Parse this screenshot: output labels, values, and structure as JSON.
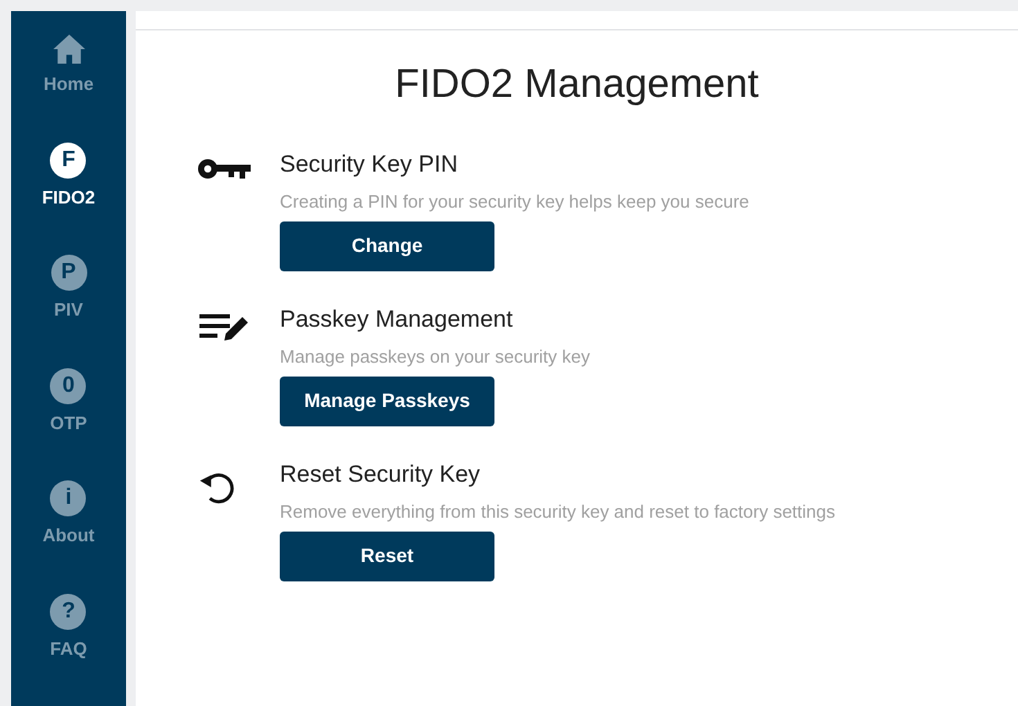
{
  "sidebar": {
    "items": [
      {
        "kind": "home",
        "label": "Home",
        "selected": false
      },
      {
        "kind": "badge",
        "badge": "F",
        "label": "FIDO2",
        "selected": true
      },
      {
        "kind": "badge",
        "badge": "P",
        "label": "PIV",
        "selected": false
      },
      {
        "kind": "badge",
        "badge": "0",
        "label": "OTP",
        "selected": false
      },
      {
        "kind": "badge",
        "badge": "i",
        "label": "About",
        "selected": false
      },
      {
        "kind": "badge",
        "badge": "?",
        "label": "FAQ",
        "selected": false
      }
    ]
  },
  "page": {
    "title": "FIDO2 Management",
    "sections": [
      {
        "kind": "key",
        "title": "Security Key PIN",
        "description": "Creating a PIN for your security key helps keep you secure",
        "button": "Change"
      },
      {
        "kind": "list",
        "title": "Passkey Management",
        "description": "Manage passkeys on your security key",
        "button": "Manage Passkeys"
      },
      {
        "kind": "reset",
        "title": "Reset Security Key",
        "description": "Remove everything from this security key and reset to factory settings",
        "button": "Reset"
      }
    ]
  }
}
